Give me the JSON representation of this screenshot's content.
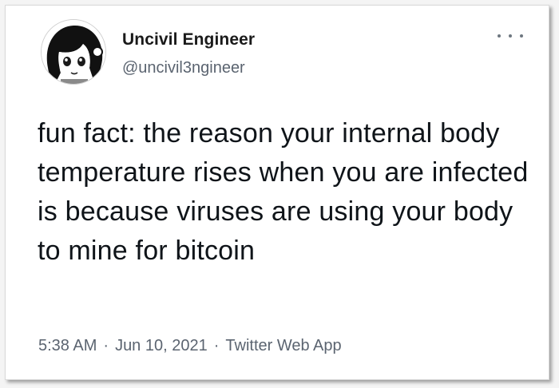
{
  "tweet": {
    "author": {
      "display_name": "Uncivil Engineer",
      "handle": "@uncivil3ngineer",
      "avatar_icon": "anime-girl-avatar-icon"
    },
    "more_icon": "more-options-icon",
    "text": "fun fact: the reason your internal body temperature rises when you are infected is because viruses are using your body to mine for bitcoin",
    "time": "5:38 AM",
    "date": "Jun 10, 2021",
    "source": "Twitter Web App",
    "separator": "·"
  },
  "colors": {
    "background": "#ffffff",
    "text": "#0f1419",
    "secondary_text": "#5b6470"
  }
}
